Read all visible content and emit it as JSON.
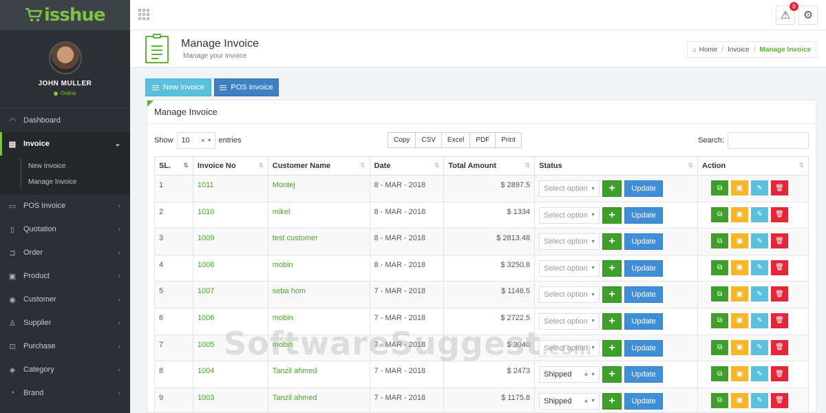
{
  "brand": {
    "name": "isshue",
    "logo_icon": "cart-icon"
  },
  "user": {
    "name": "JOHN MULLER",
    "status": "Online"
  },
  "sidebar": {
    "items": [
      {
        "label": "Dashboard",
        "icon": "dashboard-icon",
        "glyph": "◠",
        "chevron": ""
      },
      {
        "label": "Invoice",
        "icon": "invoice-icon",
        "glyph": "▤",
        "chevron": "⌄",
        "active": true
      },
      {
        "label": "POS Invoice",
        "icon": "pos-invoice-icon",
        "glyph": "▭",
        "chevron": "‹"
      },
      {
        "label": "Quotation",
        "icon": "quotation-icon",
        "glyph": "▯",
        "chevron": "‹"
      },
      {
        "label": "Order",
        "icon": "order-icon",
        "glyph": "⊐",
        "chevron": "‹"
      },
      {
        "label": "Product",
        "icon": "product-icon",
        "glyph": "▣",
        "chevron": "‹"
      },
      {
        "label": "Customer",
        "icon": "customer-icon",
        "glyph": "◉",
        "chevron": "‹"
      },
      {
        "label": "Supplier",
        "icon": "supplier-icon",
        "glyph": "♙",
        "chevron": "‹"
      },
      {
        "label": "Purchase",
        "icon": "purchase-icon",
        "glyph": "⊡",
        "chevron": "‹"
      },
      {
        "label": "Category",
        "icon": "category-icon",
        "glyph": "◈",
        "chevron": "‹"
      },
      {
        "label": "Brand",
        "icon": "brand-icon",
        "glyph": "◔",
        "chevron": "‹"
      }
    ],
    "invoice_submenu": [
      "New Invoice",
      "Manage Invoice"
    ]
  },
  "topbar": {
    "notification_count": "0"
  },
  "page_header": {
    "title": "Manage Invoice",
    "subtitle": "Manage your invoice",
    "breadcrumb": {
      "home": "Home",
      "parent": "Invoice",
      "current": "Manage Invoice"
    }
  },
  "buttons": {
    "new_invoice": "New Invoice",
    "pos_invoice": "POS Invoice"
  },
  "panel": {
    "title": "Manage Invoice",
    "show_label": "Show",
    "entries_value": "10",
    "entries_label": "entries",
    "export_buttons": [
      "Copy",
      "CSV",
      "Excel",
      "PDF",
      "Print"
    ],
    "search_label": "Search:"
  },
  "table": {
    "columns": [
      "SL.",
      "Invoice No",
      "Customer Name",
      "Date",
      "Total Amount",
      "Status",
      "Action"
    ],
    "update_label": "Update",
    "status_placeholder": "Select option",
    "rows": [
      {
        "sl": "1",
        "invoice": "1011",
        "customer": "Montej",
        "date": "8 - MAR - 2018",
        "amount": "$ 2897.5",
        "status": ""
      },
      {
        "sl": "2",
        "invoice": "1010",
        "customer": "mikel",
        "date": "8 - MAR - 2018",
        "amount": "$ 1334",
        "status": ""
      },
      {
        "sl": "3",
        "invoice": "1009",
        "customer": "test customer",
        "date": "8 - MAR - 2018",
        "amount": "$ 2813.48",
        "status": ""
      },
      {
        "sl": "4",
        "invoice": "1008",
        "customer": "mobin",
        "date": "8 - MAR - 2018",
        "amount": "$ 3250.8",
        "status": ""
      },
      {
        "sl": "5",
        "invoice": "1007",
        "customer": "seba hom",
        "date": "7 - MAR - 2018",
        "amount": "$ 1146.5",
        "status": ""
      },
      {
        "sl": "6",
        "invoice": "1006",
        "customer": "mobin",
        "date": "7 - MAR - 2018",
        "amount": "$ 2722.5",
        "status": ""
      },
      {
        "sl": "7",
        "invoice": "1005",
        "customer": "mobin",
        "date": "7 - MAR - 2018",
        "amount": "$ 3040",
        "status": ""
      },
      {
        "sl": "8",
        "invoice": "1004",
        "customer": "Tanzil ahmed",
        "date": "7 - MAR - 2018",
        "amount": "$ 2473",
        "status": "Shipped"
      },
      {
        "sl": "9",
        "invoice": "1003",
        "customer": "Tanzil ahmed",
        "date": "7 - MAR - 2018",
        "amount": "$ 1175.8",
        "status": "Shipped"
      }
    ]
  },
  "watermark": {
    "text": "SoftwareSuggest",
    "suffix": ".com"
  },
  "colors": {
    "accent": "#5fb233",
    "sidebar_bg": "#2c3034",
    "update_btn": "#3f8ed8",
    "delete_btn": "#e0283a"
  }
}
